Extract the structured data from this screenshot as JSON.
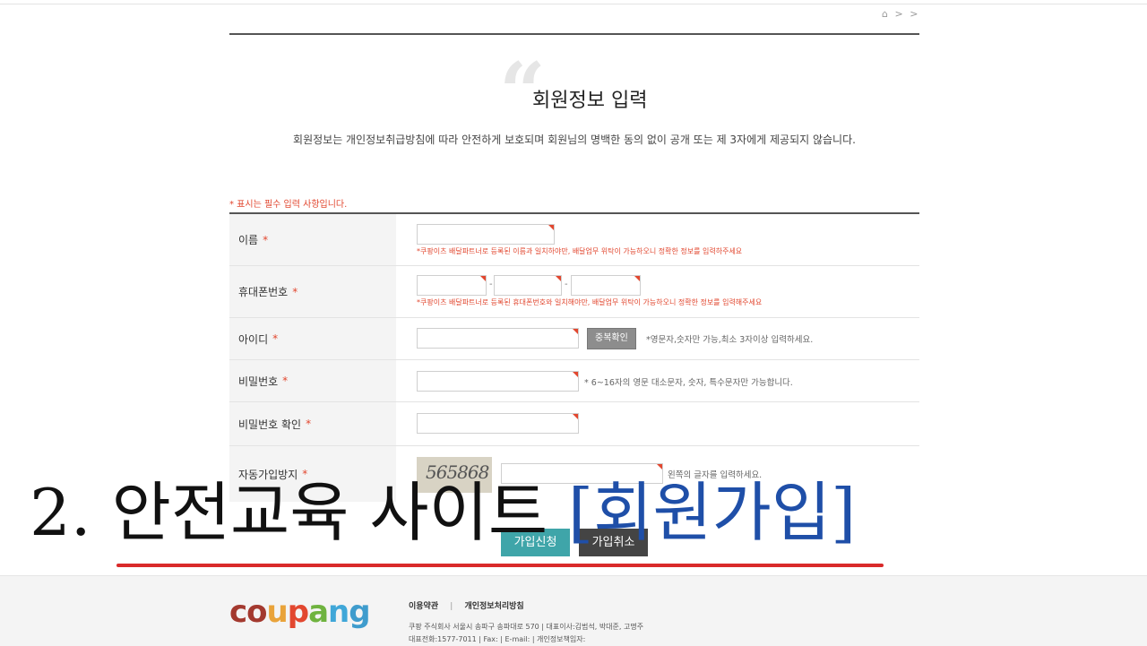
{
  "breadcrumb": {
    "home_icon": "home-icon",
    "chev1": ">",
    "chev2": ">"
  },
  "page": {
    "title": "회원정보 입력",
    "subtitle": "회원정보는 개인정보취급방침에 따라 안전하게 보호되며 회원님의 명백한 동의 없이 공개 또는 제 3자에게 제공되지 않습니다.",
    "required_note": "* 표시는 필수 입력 사항입니다."
  },
  "form": {
    "name": {
      "label": "이름",
      "star": "*",
      "value": "",
      "warning": "*쿠팡이츠 배달파트너로 등록된 이름과 일치하야만, 배달업무 위탁이 가능하오니 정확한 정보를 입력하주세요"
    },
    "phone": {
      "label": "휴대폰번호",
      "star": "*",
      "dash1": "-",
      "dash2": "-",
      "part1": "",
      "part2": "",
      "part3": "",
      "warning": "*쿠팡이츠 배달파트너로 등록된 휴대폰번호와 일치해야만, 배달업무 위탁이 가능하오니 정확한 정보를 입력해주세요"
    },
    "userid": {
      "label": "아이디",
      "star": "*",
      "value": "",
      "dup_button": "중복확인",
      "hint": "*영문자,숫자만 가능,최소 3자이상 입력하세요."
    },
    "password": {
      "label": "비밀번호",
      "star": "*",
      "value": "",
      "hint": "* 6~16자의 영문 대소문자, 숫자, 특수문자만 가능합니다."
    },
    "password_confirm": {
      "label": "비밀번호 확인",
      "star": "*",
      "value": ""
    },
    "captcha": {
      "label": "자동가입방지",
      "star": "*",
      "code": "565868",
      "value": "",
      "hint": "왼쪽의 글자를 입력하세요."
    }
  },
  "buttons": {
    "join": "가입신청",
    "cancel": "가입취소"
  },
  "overlay": {
    "prefix": "2. 안전교육 사이트 ",
    "highlight": "[회원가입]"
  },
  "footer": {
    "logo_parts": [
      {
        "text": "co",
        "color": "#a3392f"
      },
      {
        "text": "u",
        "color": "#e9a33a"
      },
      {
        "text": "p",
        "color": "#e2472f"
      },
      {
        "text": "a",
        "color": "#6fb33f"
      },
      {
        "text": "n",
        "color": "#40a7d8"
      },
      {
        "text": "g",
        "color": "#3f9ccd"
      }
    ],
    "terms": "이용약관",
    "sep": "|",
    "privacy": "개인정보처리방침",
    "address": "쿠팡 주식회사 서울시 송파구 송파대로 570 | 대표이사:김범석, 박대준, 고명주",
    "contact": "대표전화:1577-7011 | Fax: | E-mail: | 개인정보책임자:"
  },
  "colors": {
    "accent_red": "#e2472f",
    "join_button": "#3fa5a9",
    "cancel_button": "#444444",
    "overlay_blue": "#1f4fa8",
    "underline_red": "#d92a2a"
  }
}
